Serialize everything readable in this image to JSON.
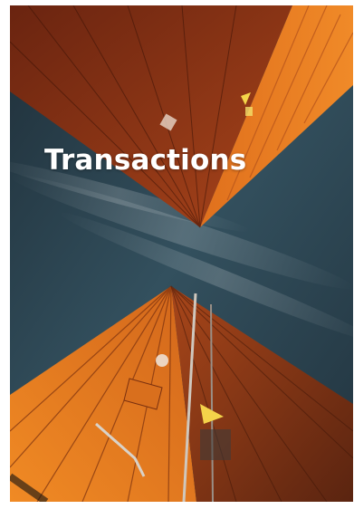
{
  "hero": {
    "title": "Transactions",
    "image_subject": "orange-shipping-containers-from-below",
    "colors": {
      "container_orange": "#e8791f",
      "sky": "#2b3f4b",
      "title_text": "#ffffff"
    }
  }
}
